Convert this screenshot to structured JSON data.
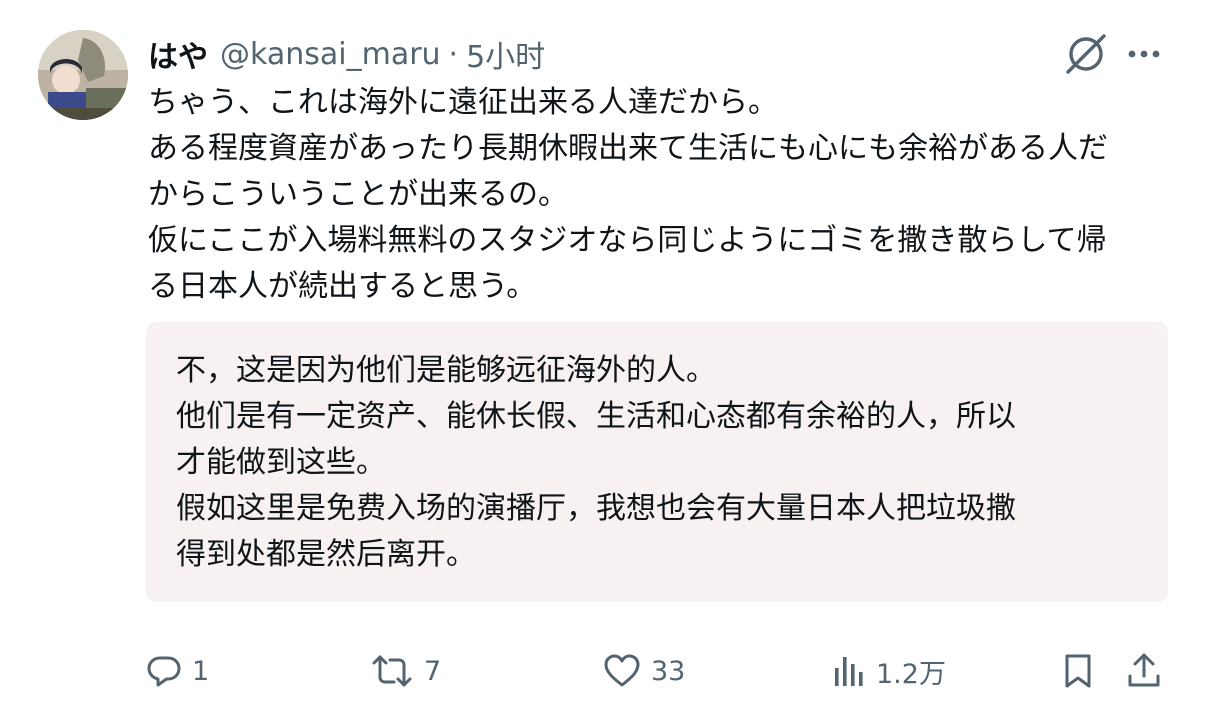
{
  "user": {
    "display_name": "はや",
    "handle": "@kansai_maru",
    "separator": "·",
    "time": "5小时"
  },
  "tweet": {
    "lines": [
      "ちゃう、これは海外に遠征出来る人達だから。",
      "ある程度資産があったり長期休暇出来て生活にも心にも余裕がある人だ",
      "からこういうことが出来るの。",
      "仮にここが入場料無料のスタジオなら同じようにゴミを撒き散らして帰",
      "る日本人が続出すると思う。"
    ]
  },
  "translation": {
    "lines": [
      "不，这是因为他们是能够远征海外的人。",
      "他们是有一定资产、能休长假、生活和心态都有余裕的人，所以",
      "才能做到这些。",
      "假如这里是免费入场的演播厅，我想也会有大量日本人把垃圾撒",
      "得到处都是然后离开。"
    ]
  },
  "actions": {
    "reply_count": "1",
    "retweet_count": "7",
    "like_count": "33",
    "views_count": "1.2万"
  },
  "icons": {
    "grok": "grok-icon",
    "more": "more-icon",
    "reply": "reply-icon",
    "retweet": "retweet-icon",
    "like": "heart-icon",
    "views": "views-icon",
    "bookmark": "bookmark-icon",
    "share": "share-icon"
  },
  "colors": {
    "text": "#0f1419",
    "muted": "#536471",
    "translation_bg": "#f7f1f1"
  }
}
